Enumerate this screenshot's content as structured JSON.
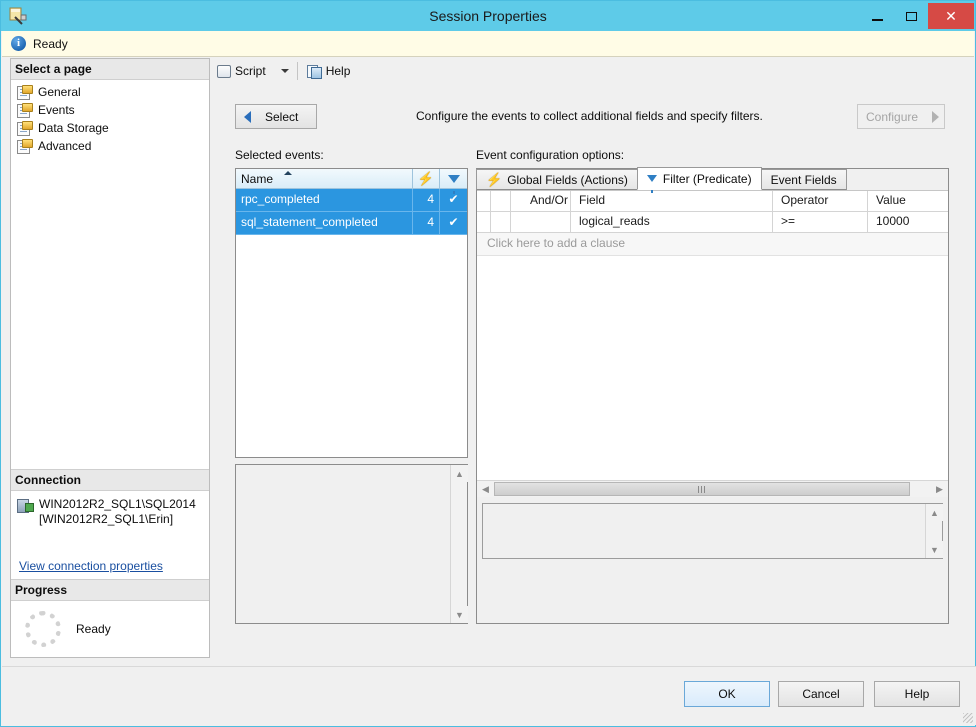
{
  "window": {
    "title": "Session Properties",
    "icon": "session-properties-icon",
    "controls": {
      "minimize": "minimize-button",
      "maximize": "maximize-button",
      "close": "✕"
    }
  },
  "status": {
    "icon": "info-icon",
    "text": "Ready"
  },
  "sidebar": {
    "header": "Select a page",
    "items": [
      {
        "label": "General",
        "icon": "page-icon"
      },
      {
        "label": "Events",
        "icon": "page-icon"
      },
      {
        "label": "Data Storage",
        "icon": "page-icon"
      },
      {
        "label": "Advanced",
        "icon": "page-icon"
      }
    ],
    "connection": {
      "header": "Connection",
      "server_line1": "WIN2012R2_SQL1\\SQL2014",
      "server_line2": "[WIN2012R2_SQL1\\Erin]",
      "link": "View connection properties"
    },
    "progress": {
      "header": "Progress",
      "text": "Ready"
    }
  },
  "toolbar": {
    "script_label": "Script",
    "help_label": "Help"
  },
  "actions": {
    "select_label": "Select",
    "configure_label": "Configure",
    "configure_enabled": false,
    "description": "Configure the events to collect additional fields and specify filters."
  },
  "selected_events": {
    "label": "Selected events:",
    "columns": [
      "Name",
      "bolt-icon",
      "filter-icon"
    ],
    "name_header": "Name",
    "rows": [
      {
        "name": "rpc_completed",
        "count": "4",
        "filtered": "✔"
      },
      {
        "name": "sql_statement_completed",
        "count": "4",
        "filtered": "✔"
      }
    ]
  },
  "event_config": {
    "label": "Event configuration options:",
    "tabs": [
      {
        "label": "Global Fields (Actions)",
        "icon": "bolt-icon",
        "active": false
      },
      {
        "label": "Filter (Predicate)",
        "icon": "filter-icon",
        "active": true
      },
      {
        "label": "Event Fields",
        "icon": "",
        "active": false
      }
    ],
    "grid": {
      "columns": [
        "",
        "",
        "And/Or",
        "Field",
        "Operator",
        "Value"
      ],
      "col_andor": "And/Or",
      "col_field": "Field",
      "col_operator": "Operator",
      "col_value": "Value",
      "rows": [
        {
          "andor": "",
          "field": "logical_reads",
          "operator": ">=",
          "value": "10000"
        }
      ],
      "add_clause_text": "Click here to add a clause"
    }
  },
  "footer": {
    "ok": "OK",
    "cancel": "Cancel",
    "help": "Help"
  },
  "colors": {
    "titlebar": "#5ECBE8",
    "close_button": "#d64a45",
    "status_bg": "#fffce6",
    "selection_blue": "#2b96e0",
    "link": "#1a4fa0"
  }
}
